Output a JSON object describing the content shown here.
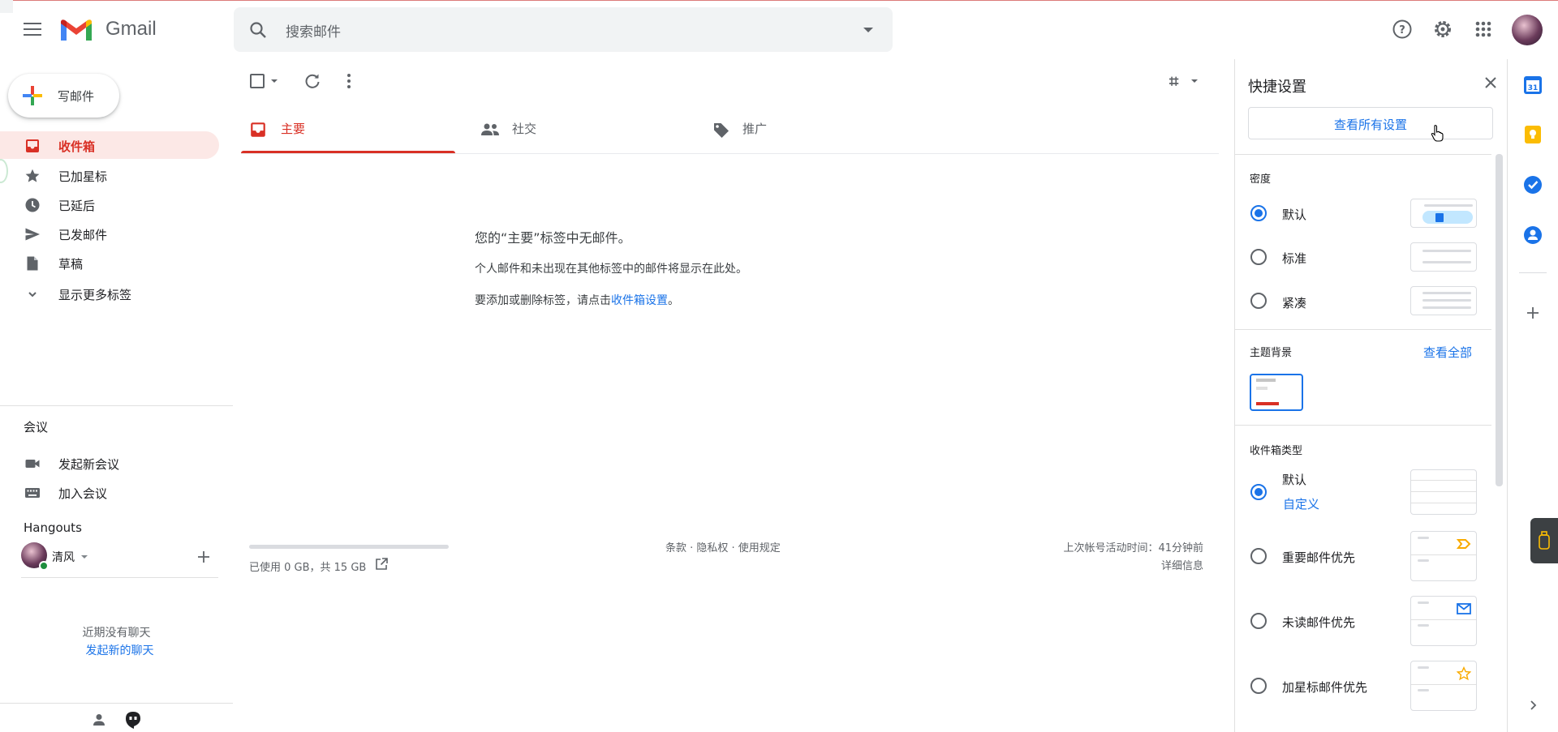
{
  "header": {
    "logo_text": "Gmail",
    "search_placeholder": "搜索邮件"
  },
  "compose": {
    "label": "写邮件"
  },
  "nav": [
    {
      "label": "收件箱",
      "icon": "inbox-icon"
    },
    {
      "label": "已加星标",
      "icon": "star-icon"
    },
    {
      "label": "已延后",
      "icon": "clock-icon"
    },
    {
      "label": "已发邮件",
      "icon": "send-icon"
    },
    {
      "label": "草稿",
      "icon": "draft-icon"
    },
    {
      "label": "显示更多标签",
      "icon": "chevron-down-icon"
    }
  ],
  "meet": {
    "title": "会议",
    "new_meeting": "发起新会议",
    "join_meeting": "加入会议"
  },
  "hangouts": {
    "title": "Hangouts",
    "user": "清风",
    "no_chats": "近期没有聊天",
    "start_chat": "发起新的聊天"
  },
  "tabs": [
    {
      "label": "主要"
    },
    {
      "label": "社交"
    },
    {
      "label": "推广"
    }
  ],
  "empty": {
    "title": "您的“主要”标签中无邮件。",
    "line1": "个人邮件和未出现在其他标签中的邮件将显示在此处。",
    "line2_prefix": "要添加或删除标签，请点击",
    "line2_link": "收件箱设置",
    "line2_suffix": "。"
  },
  "footer": {
    "storage": "已使用 0 GB，共 15 GB",
    "links": "条款 · 隐私权 · 使用规定",
    "activity": "上次帐号活动时间：41分钟前",
    "details": "详细信息"
  },
  "quick_settings": {
    "title": "快捷设置",
    "see_all_settings": "查看所有设置",
    "density_title": "密度",
    "density_options": [
      "默认",
      "标准",
      "紧凑"
    ],
    "density_selected": "默认",
    "theme_title": "主题背景",
    "theme_see_all": "查看全部",
    "inbox_type_title": "收件箱类型",
    "inbox_default": "默认",
    "inbox_customize": "自定义",
    "inbox_options": [
      "重要邮件优先",
      "未读邮件优先",
      "加星标邮件优先"
    ]
  },
  "colors": {
    "accent_red": "#d93025",
    "link_blue": "#1a73e8",
    "active_bg": "#fce8e6"
  }
}
